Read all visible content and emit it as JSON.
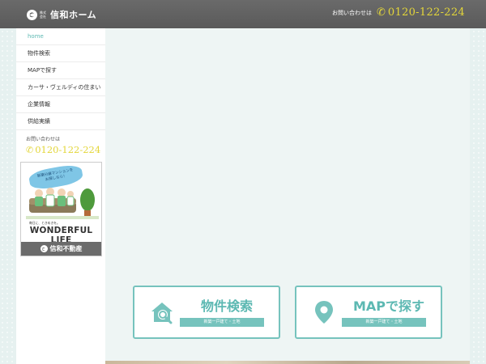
{
  "header": {
    "logo_small": "株式会社",
    "logo_text": "信和ホーム",
    "contact_label": "お問い合わせは",
    "phone": "0120-122-224"
  },
  "sidebar": {
    "items": [
      {
        "label": "home",
        "active": true
      },
      {
        "label": "物件検索"
      },
      {
        "label": "MAPで探す"
      },
      {
        "label": "カーサ・ヴェルディの住まい"
      },
      {
        "label": "企業情報"
      },
      {
        "label": "供給実績"
      }
    ],
    "contact_label": "お問い合わせは",
    "phone": "0120-122-224",
    "banner": {
      "bubble": "新築分譲マンションを\nお探しなら！",
      "sub": "毎日に、ときめきを。",
      "title": "WONDERFUL LIFE",
      "footer": "信和不動産"
    }
  },
  "cards": [
    {
      "title": "物件検索",
      "tag": "新築一戸建て・土地",
      "icon": "house-search-icon"
    },
    {
      "title": "MAPで探す",
      "tag": "新築一戸建て・土地",
      "icon": "map-pin-icon"
    }
  ],
  "colors": {
    "accent": "#5cb8b2",
    "phone": "#e3d63a",
    "header_bg": "#5f5f5f"
  }
}
